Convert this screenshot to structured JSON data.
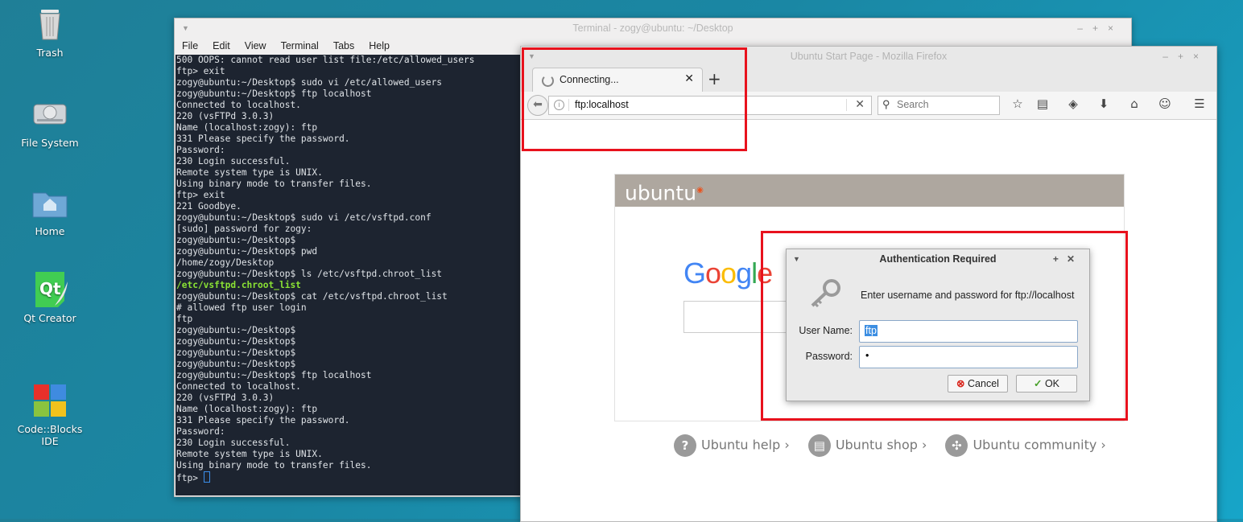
{
  "desktop": {
    "icons": [
      {
        "label": "Trash",
        "icon": "trash-icon"
      },
      {
        "label": "File System",
        "icon": "drive-icon"
      },
      {
        "label": "Home",
        "icon": "home-folder-icon"
      },
      {
        "label": "Qt Creator",
        "icon": "qt-creator-icon"
      },
      {
        "label": "Code::Blocks\nIDE",
        "icon": "codeblocks-icon"
      }
    ]
  },
  "terminal": {
    "title": "Terminal - zogy@ubuntu: ~/Desktop",
    "menu": [
      "File",
      "Edit",
      "View",
      "Terminal",
      "Tabs",
      "Help"
    ],
    "lines": [
      "500 OOPS: cannot read user list file:/etc/allowed_users",
      "ftp> exit",
      "zogy@ubuntu:~/Desktop$ sudo vi /etc/allowed_users",
      "zogy@ubuntu:~/Desktop$ ftp localhost",
      "Connected to localhost.",
      "220 (vsFTPd 3.0.3)",
      "Name (localhost:zogy): ftp",
      "331 Please specify the password.",
      "Password:",
      "230 Login successful.",
      "Remote system type is UNIX.",
      "Using binary mode to transfer files.",
      "ftp> exit",
      "221 Goodbye.",
      "zogy@ubuntu:~/Desktop$ sudo vi /etc/vsftpd.conf",
      "[sudo] password for zogy:",
      "zogy@ubuntu:~/Desktop$",
      "zogy@ubuntu:~/Desktop$ pwd",
      "/home/zogy/Desktop",
      "zogy@ubuntu:~/Desktop$ ls /etc/vsftpd.chroot_list",
      "/etc/vsftpd.chroot_list",
      "zogy@ubuntu:~/Desktop$ cat /etc/vsftpd.chroot_list",
      "# allowed ftp user login",
      "ftp",
      "zogy@ubuntu:~/Desktop$",
      "zogy@ubuntu:~/Desktop$",
      "zogy@ubuntu:~/Desktop$",
      "zogy@ubuntu:~/Desktop$",
      "zogy@ubuntu:~/Desktop$ ftp localhost",
      "Connected to localhost.",
      "220 (vsFTPd 3.0.3)",
      "Name (localhost:zogy): ftp",
      "331 Please specify the password.",
      "Password:",
      "230 Login successful.",
      "Remote system type is UNIX.",
      "Using binary mode to transfer files."
    ],
    "highlight_line": "/etc/vsftpd.chroot_list",
    "prompt": "ftp> "
  },
  "firefox": {
    "title": "Ubuntu Start Page - Mozilla Firefox",
    "tab_label": "Connecting...",
    "url": "ftp:localhost",
    "search_placeholder": "Search",
    "brand": "ubuntu",
    "google": "Google",
    "links": [
      {
        "label": "Ubuntu help ›",
        "icon": "help-icon",
        "glyph": "?"
      },
      {
        "label": "Ubuntu shop ›",
        "icon": "shop-icon",
        "glyph": "▤"
      },
      {
        "label": "Ubuntu community ›",
        "icon": "community-icon",
        "glyph": "✣"
      }
    ]
  },
  "auth_dialog": {
    "title": "Authentication Required",
    "message": "Enter username and password for ftp://localhost",
    "username_label": "User Name:",
    "username_value": "ftp",
    "password_label": "Password:",
    "password_value": "•",
    "cancel_label": "Cancel",
    "ok_label": "OK"
  },
  "colors": {
    "highlight_box": "#e8121d",
    "terminal_bg": "#1d2430",
    "ubuntu_header": "#aea79f"
  }
}
